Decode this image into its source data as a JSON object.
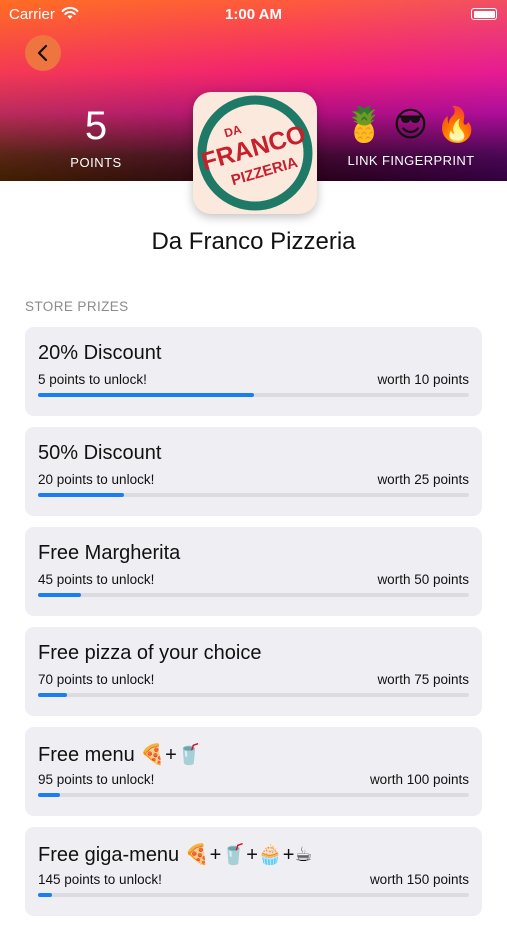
{
  "status": {
    "carrier": "Carrier",
    "time": "1:00 AM"
  },
  "header": {
    "points_value": "5",
    "points_label": "POINTS",
    "emojis": [
      "🍍",
      "😎",
      "🔥"
    ],
    "link_label": "LINK FINGERPRINT",
    "logo_text": {
      "top": "DA",
      "main": "FRANCO",
      "bottom": "PIZZERIA"
    }
  },
  "store_name": "Da Franco Pizzeria",
  "section_title": "STORE PRIZES",
  "prizes": [
    {
      "title": "20% Discount",
      "unlock": "5 points to unlock!",
      "worth": "worth 10 points",
      "progress": 0.5
    },
    {
      "title": "50% Discount",
      "unlock": "20 points to unlock!",
      "worth": "worth 25 points",
      "progress": 0.2
    },
    {
      "title": "Free Margherita",
      "unlock": "45 points to unlock!",
      "worth": "worth 50 points",
      "progress": 0.1
    },
    {
      "title": "Free pizza of your choice",
      "unlock": "70 points to unlock!",
      "worth": "worth 75 points",
      "progress": 0.067
    },
    {
      "title": "Free menu 🍕+🥤",
      "unlock": "95 points to unlock!",
      "worth": "worth 100 points",
      "progress": 0.05
    },
    {
      "title": "Free giga-menu 🍕+🥤+🧁+☕",
      "unlock": "145 points to unlock!",
      "worth": "worth 150 points",
      "progress": 0.033
    }
  ],
  "colors": {
    "accent": "#1a7ef2",
    "back_button": "#ee7440",
    "logo_red": "#c8202b",
    "logo_green": "#1e7a66"
  }
}
